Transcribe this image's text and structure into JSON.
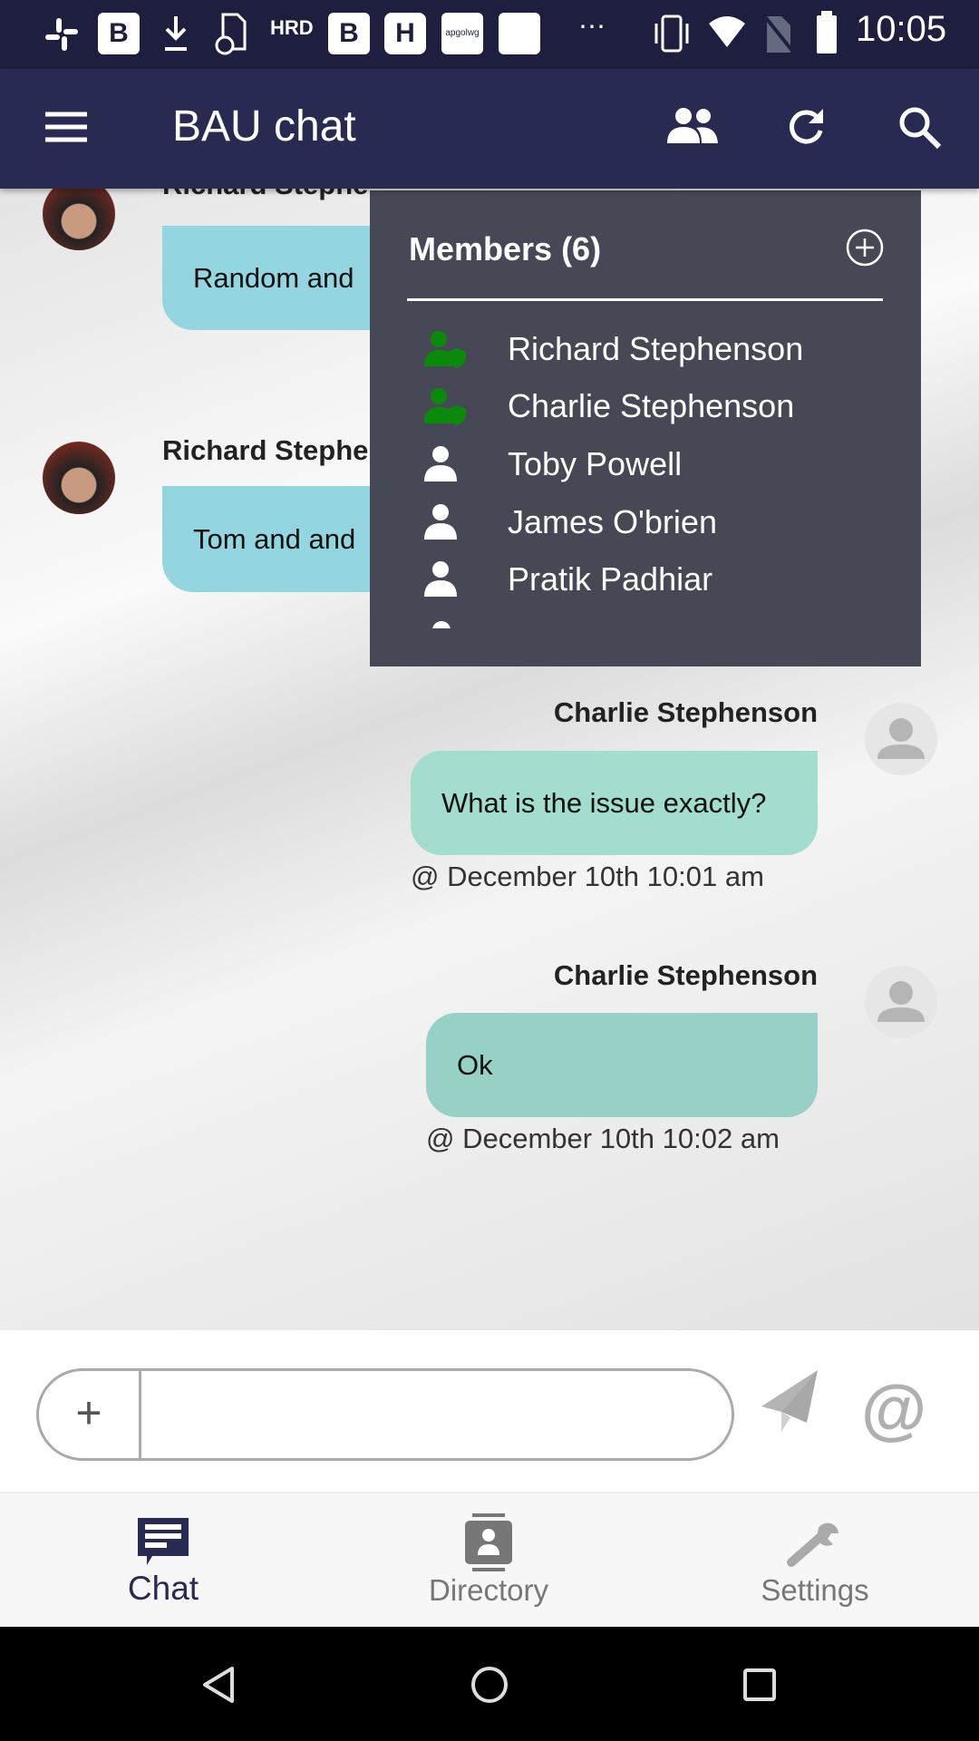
{
  "status_bar": {
    "time": "10:05",
    "notification_icons": [
      "slack-icon",
      "b-icon",
      "download-icon",
      "invoice-icon",
      "hrd-icon",
      "b-icon",
      "h-icon",
      "apgolwg-icon",
      "kroos-icon"
    ],
    "overflow": "⋯",
    "right_icons": [
      "vibrate-icon",
      "wifi-icon",
      "no-sim-icon",
      "battery-icon"
    ],
    "hrd_text": "HRD",
    "b_text": "B",
    "h_text": "H",
    "apgolwg_text": "apgolwg"
  },
  "app_bar": {
    "title": "BAU chat",
    "icons": [
      "menu-icon",
      "members-icon",
      "refresh-icon",
      "search-icon"
    ]
  },
  "messages": [
    {
      "sender": "Richard Stephe",
      "text": "Random and",
      "side": "left",
      "color": "#94d6e0"
    },
    {
      "sender": "Richard Stephe",
      "text": "Tom and and",
      "side": "left",
      "color": "#94d6e0"
    },
    {
      "sender": "Charlie Stephenson",
      "text": "What is the issue exactly?",
      "timestamp": "@ December 10th 10:01 am",
      "side": "right",
      "color": "#a2ddd0"
    },
    {
      "sender": "Charlie Stephenson",
      "text": "Ok",
      "timestamp": "@ December 10th 10:02 am",
      "side": "right",
      "color": "#97d1c6"
    }
  ],
  "members_panel": {
    "title": "Members (6)",
    "add_icon": "add-circle-icon",
    "members": [
      {
        "name": "Richard Stephenson",
        "role": "admin",
        "icon_color": "#0a8a0a"
      },
      {
        "name": "Charlie Stephenson",
        "role": "admin",
        "icon_color": "#0a8a0a"
      },
      {
        "name": "Toby Powell",
        "role": "member",
        "icon_color": "#ffffff"
      },
      {
        "name": "James O'brien",
        "role": "member",
        "icon_color": "#ffffff"
      },
      {
        "name": "Pratik Padhiar",
        "role": "member",
        "icon_color": "#ffffff"
      }
    ]
  },
  "composer": {
    "value": "",
    "placeholder": "",
    "attach_label": "+",
    "mention_label": "@"
  },
  "bottom_nav": {
    "tabs": [
      {
        "label": "Chat",
        "active": true
      },
      {
        "label": "Directory",
        "active": false
      },
      {
        "label": "Settings",
        "active": false
      }
    ],
    "active_color": "#282a52"
  },
  "colors": {
    "app_bar": "#282a52",
    "status_bar": "#1e1f3f",
    "panel": "#464955"
  }
}
